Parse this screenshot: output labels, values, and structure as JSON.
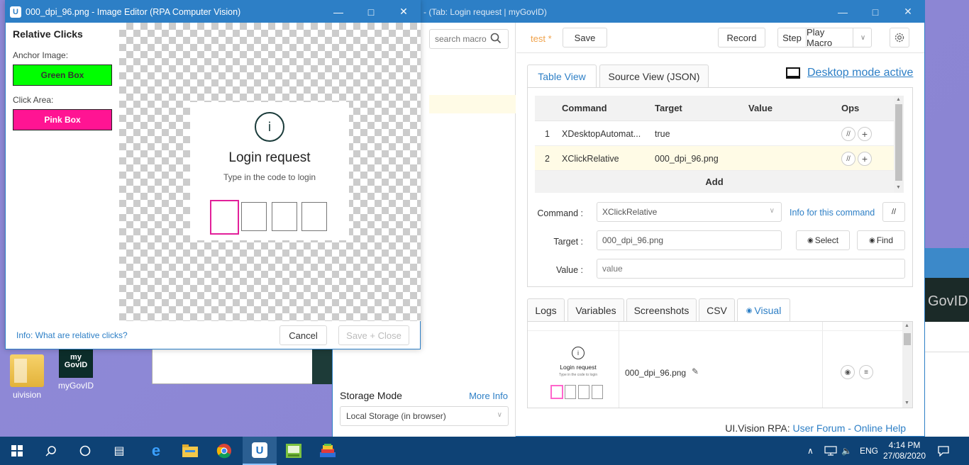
{
  "desktop": {
    "icons": [
      {
        "label": "uivision"
      },
      {
        "label": "myGovID"
      }
    ],
    "bg_page_text": "GovID"
  },
  "main_window": {
    "title": "- (Tab: Login request | myGovID)",
    "sidebar": {
      "search_placeholder": "search macro",
      "storage_label": "Storage Mode",
      "storage_more": "More Info",
      "storage_value": "Local Storage (in browser)"
    },
    "toolbar": {
      "macro_name": "test *",
      "save": "Save",
      "record": "Record",
      "step": "Step",
      "play": "Play Macro"
    },
    "tabs": [
      {
        "label": "Table View"
      },
      {
        "label": "Source View (JSON)"
      }
    ],
    "desktop_mode": "Desktop mode active",
    "table": {
      "headers": [
        "Command",
        "Target",
        "Value",
        "Ops"
      ],
      "rows": [
        {
          "num": "1",
          "command": "XDesktopAutomat...",
          "target": "true",
          "value": ""
        },
        {
          "num": "2",
          "command": "XClickRelative",
          "target": "000_dpi_96.png",
          "value": ""
        }
      ],
      "add_label": "Add"
    },
    "form": {
      "command_label": "Command :",
      "command_value": "XClickRelative",
      "info_link": "Info for this command",
      "comment_btn": "//",
      "target_label": "Target :",
      "target_value": "000_dpi_96.png",
      "select_btn": "Select",
      "find_btn": "Find",
      "value_label": "Value :",
      "value_placeholder": "value"
    },
    "bottom_tabs": [
      {
        "label": "Logs"
      },
      {
        "label": "Variables"
      },
      {
        "label": "Screenshots"
      },
      {
        "label": "CSV"
      },
      {
        "label": "Visual"
      }
    ],
    "visual": {
      "filename": "000_dpi_96.png",
      "thumb_title": "Login request",
      "thumb_sub": "Type in the code to login"
    },
    "footer": {
      "prefix": "UI.Vision RPA:",
      "forum": "User Forum",
      "sep": "-",
      "help": "Online Help"
    }
  },
  "editor_window": {
    "title": "000_dpi_96.png - Image Editor (RPA Computer Vision)",
    "side_title": "Relative Clicks",
    "anchor_label": "Anchor Image:",
    "anchor_button": "Green Box",
    "click_label": "Click Area:",
    "click_button": "Pink Box",
    "login_title": "Login request",
    "login_sub": "Type in the code to login",
    "info_link": "Info: What are relative clicks?",
    "cancel": "Cancel",
    "save_close": "Save + Close",
    "colors": {
      "green": "#00ff00",
      "pink": "#ff1493",
      "accent": "#2d7fc6"
    }
  },
  "taskbar": {
    "language": "ENG",
    "time": "4:14 PM",
    "date": "27/08/2020"
  }
}
